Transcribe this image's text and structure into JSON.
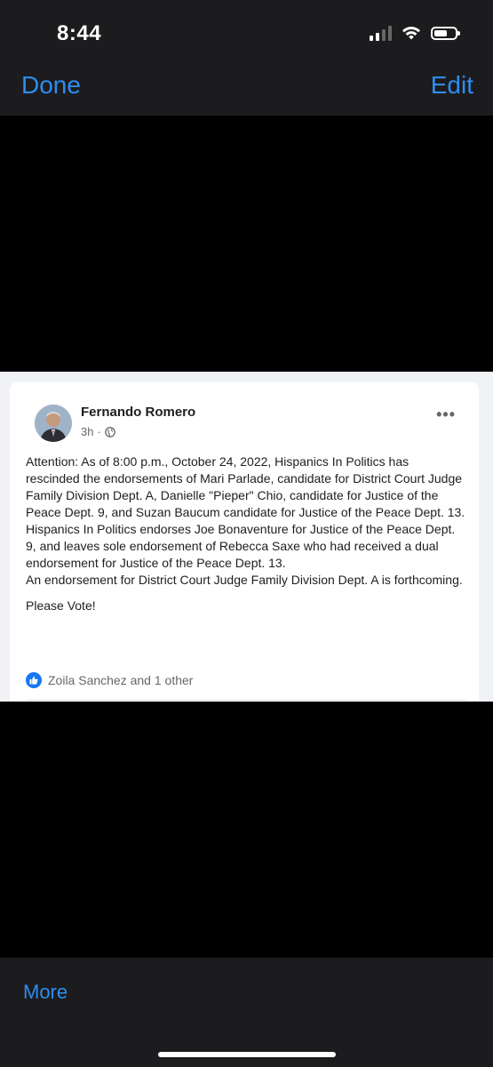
{
  "status_bar": {
    "time": "8:44",
    "icons": [
      "cellular-signal-icon",
      "wifi-icon",
      "battery-icon"
    ]
  },
  "nav": {
    "done_label": "Done",
    "edit_label": "Edit",
    "accent_color": "#2f8cf0"
  },
  "post": {
    "author": "Fernando Romero",
    "time": "3h",
    "privacy_icon": "globe-icon",
    "paragraphs": [
      "Attention:  As of 8:00 p.m., October 24, 2022, Hispanics In Politics has rescinded the endorsements of Mari Parlade, candidate for District Court Judge Family Division Dept. A, Danielle \"Pieper\" Chio, candidate for Justice of the Peace Dept. 9, and Suzan Baucum candidate for Justice of the Peace Dept. 13.",
      "Hispanics In Politics endorses Joe Bonaventure for Justice of the Peace Dept. 9, and leaves sole endorsement of Rebecca Saxe who had received a dual endorsement for Justice of the Peace Dept. 13.",
      "An endorsement for District Court Judge Family Division Dept. A is forthcoming."
    ],
    "call_to_action": "Please Vote!",
    "reactions_text": "Zoila Sanchez and 1 other",
    "like_color": "#1877f2"
  },
  "toolbar": {
    "more_label": "More"
  }
}
